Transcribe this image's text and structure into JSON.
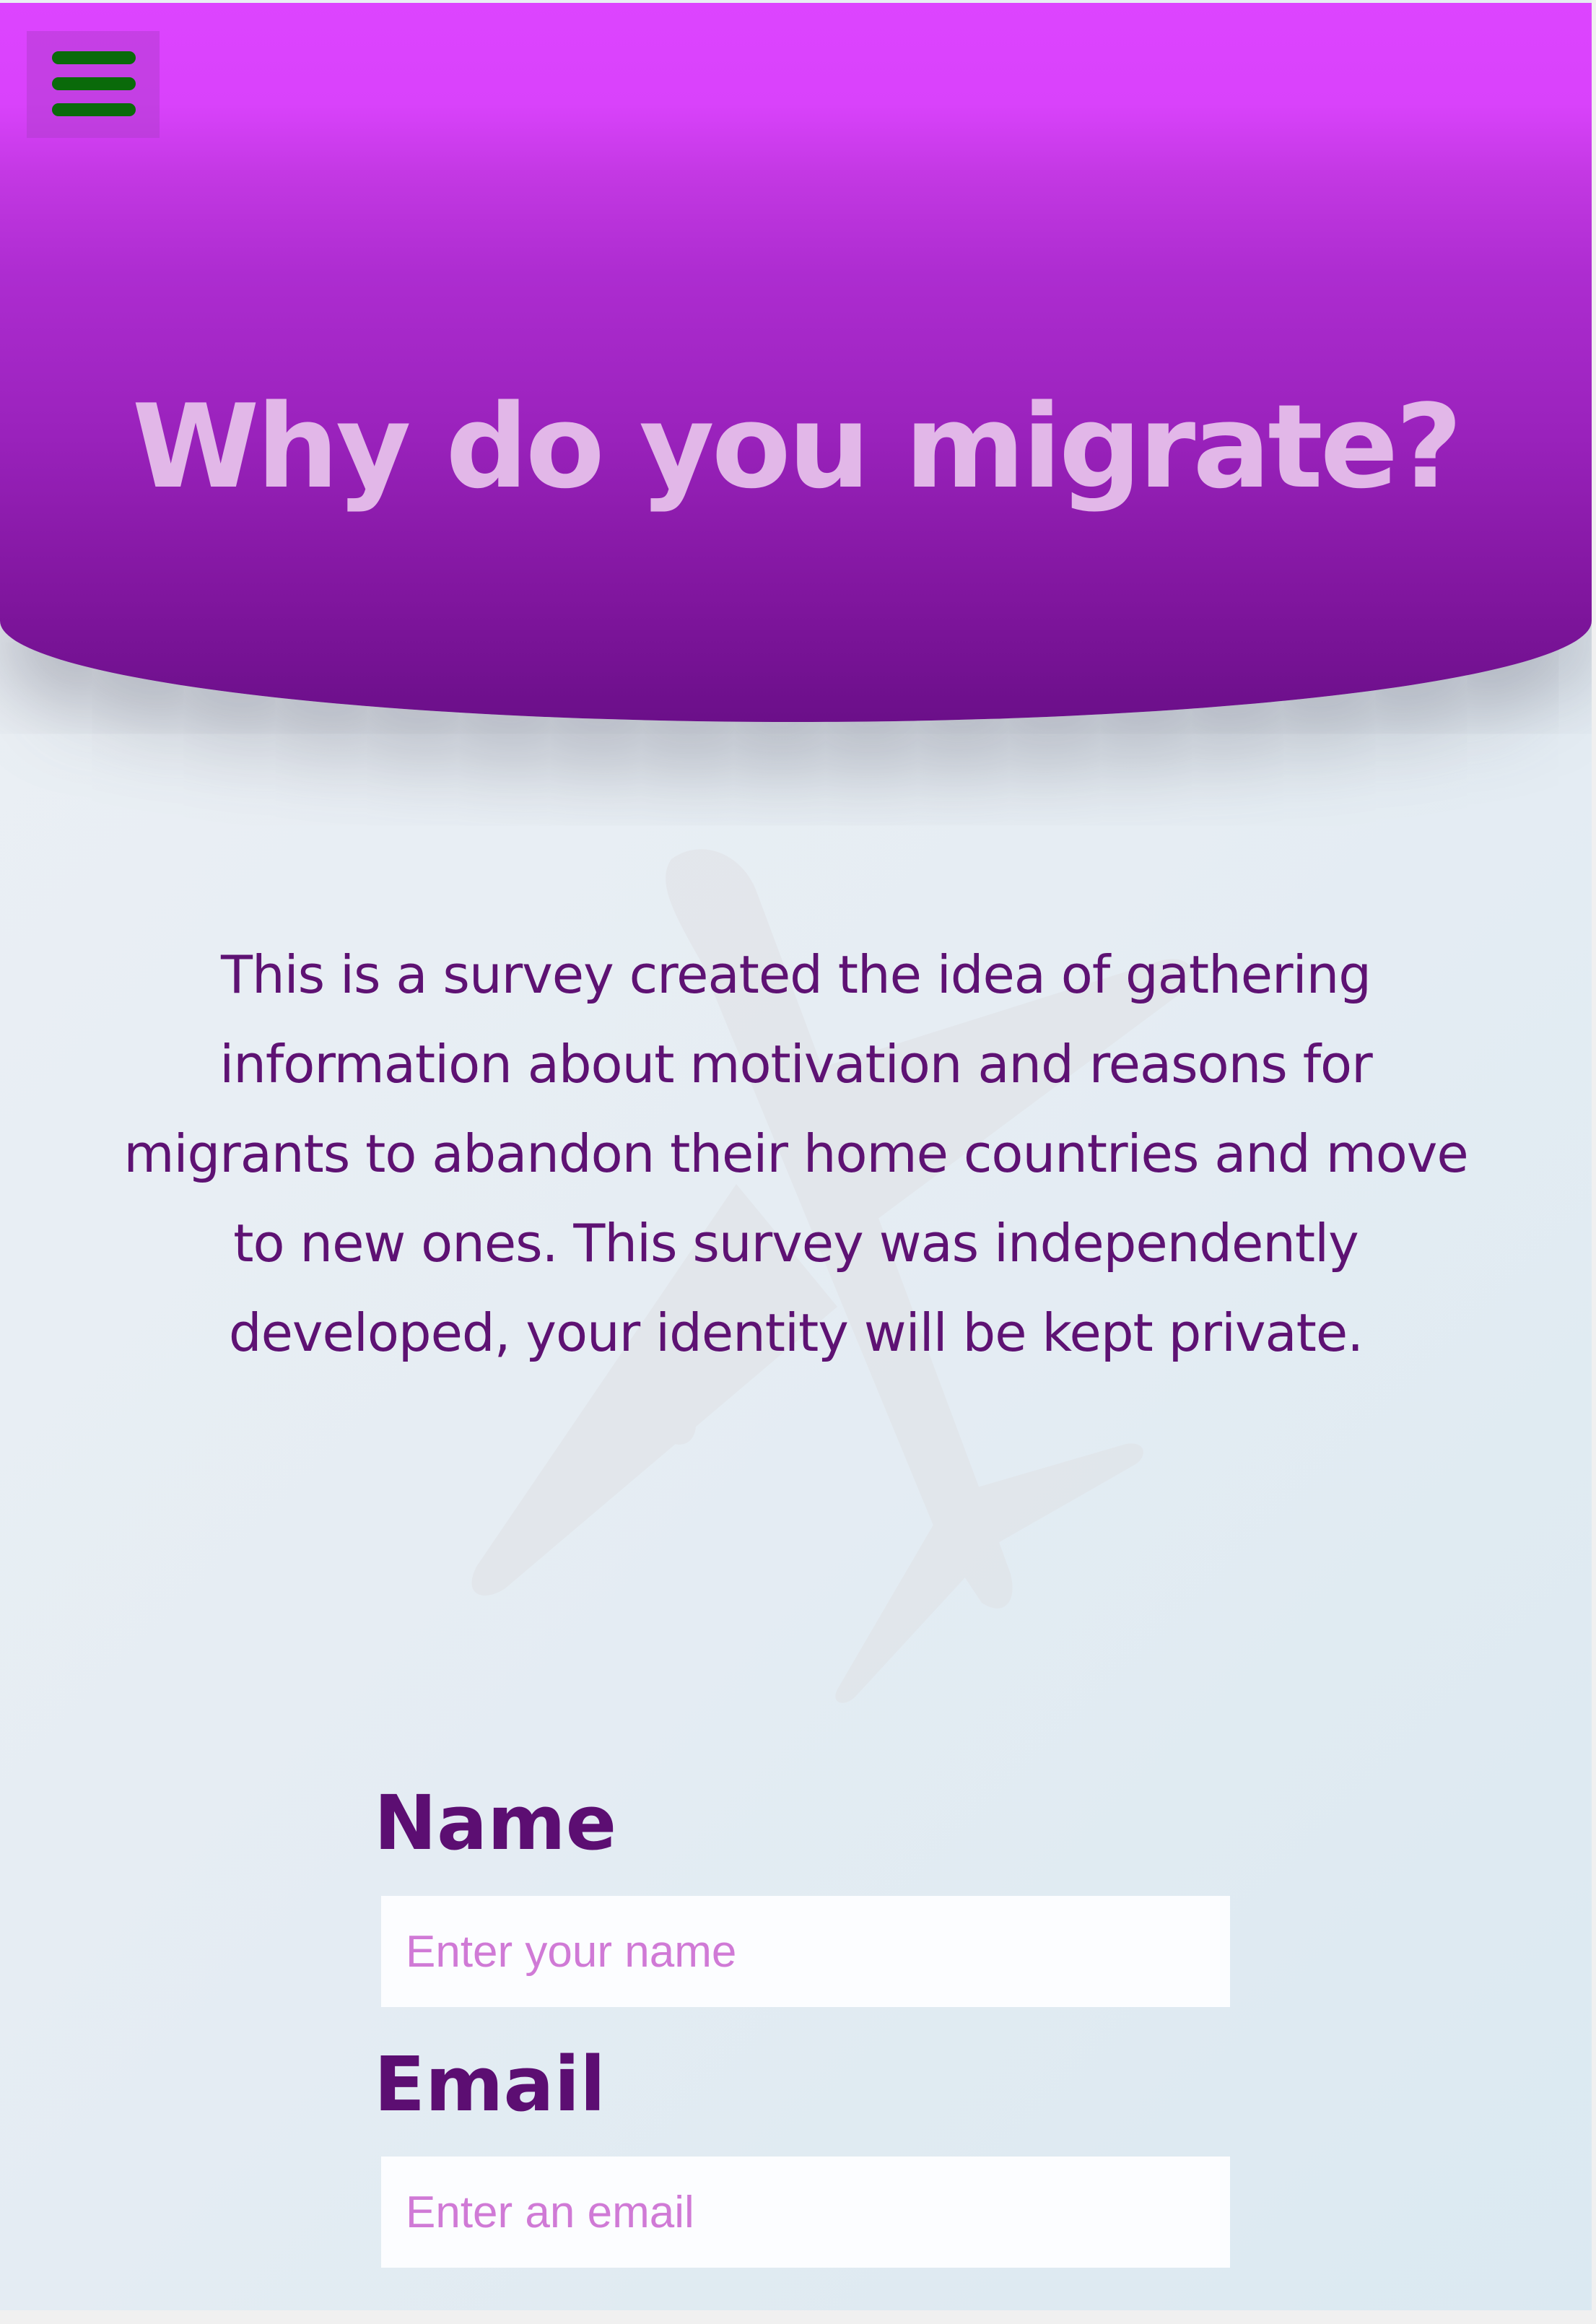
{
  "header": {
    "menu_icon": "hamburger-menu-icon",
    "menu_icon_color": "#0a6a0a",
    "title": "Why do you migrate?",
    "gradient_top": "#dd44ff",
    "gradient_bottom": "#6b0f89"
  },
  "intro": {
    "text": "This is a survey created the idea of gathering information about motivation and reasons for migrants to abandon their home countries and move to new ones. This survey was independently developed, your identity will be kept private."
  },
  "background": {
    "icon": "airplane-icon"
  },
  "form": {
    "name_label": "Name",
    "name_placeholder": "Enter your name",
    "email_label": "Email",
    "email_placeholder": "Enter an email"
  },
  "colors": {
    "label_text": "#5c0e72",
    "placeholder_text": "#d07ad6",
    "title_text": "#e2b7e8"
  }
}
